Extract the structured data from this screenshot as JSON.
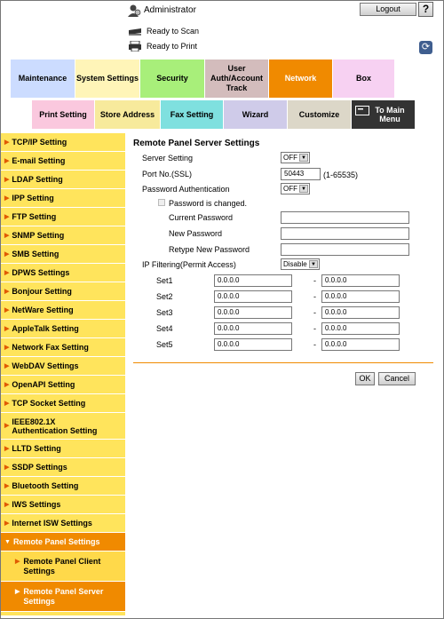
{
  "header": {
    "user": "Administrator",
    "logout_label": "Logout",
    "help_label": "?",
    "status": [
      "Ready to Scan",
      "Ready to Print"
    ]
  },
  "tabs": [
    {
      "label": "Maintenance",
      "color": "#ccdcff"
    },
    {
      "label": "System Settings",
      "color": "#fff5b8"
    },
    {
      "label": "Security",
      "color": "#a8ef7a"
    },
    {
      "label": "User Auth/Account Track",
      "color": "#d3bcbc"
    },
    {
      "label": "Network",
      "color": "#f08a00"
    },
    {
      "label": "Box",
      "color": "#f7d1f2"
    }
  ],
  "subtabs": [
    {
      "label": "Print Setting",
      "color": "#fac8de"
    },
    {
      "label": "Store Address",
      "color": "#f7ea9c"
    },
    {
      "label": "Fax Setting",
      "color": "#7fe0df"
    },
    {
      "label": "Wizard",
      "color": "#cfcbe9"
    },
    {
      "label": "Customize",
      "color": "#dcd7c8"
    },
    {
      "label": "To Main Menu",
      "color": "#333333"
    }
  ],
  "sidebar": {
    "items": [
      "TCP/IP Setting",
      "E-mail Setting",
      "LDAP Setting",
      "IPP Setting",
      "FTP Setting",
      "SNMP Setting",
      "SMB Setting",
      "DPWS Settings",
      "Bonjour Setting",
      "NetWare Setting",
      "AppleTalk Setting",
      "Network Fax Setting",
      "WebDAV Settings",
      "OpenAPI Setting",
      "TCP Socket Setting",
      "IEEE802.1X Authentication Setting",
      "LLTD Setting",
      "SSDP Settings",
      "Bluetooth Setting",
      "IWS Settings",
      "Internet ISW Settings"
    ],
    "active": "Remote Panel Settings",
    "sub": [
      "Remote Panel Client Settings",
      "Remote Panel Server Settings"
    ]
  },
  "form": {
    "title": "Remote Panel Server Settings",
    "server_setting_label": "Server Setting",
    "server_setting_value": "OFF",
    "port_label": "Port No.(SSL)",
    "port_value": "50443",
    "port_range": "(1-65535)",
    "password_auth_label": "Password Authentication",
    "password_auth_value": "OFF",
    "password_changed_label": "Password is changed.",
    "current_password_label": "Current Password",
    "new_password_label": "New Password",
    "retype_password_label": "Retype New Password",
    "ip_filtering_label": "IP Filtering(Permit Access)",
    "ip_filtering_value": "Disable",
    "sets": [
      {
        "label": "Set1",
        "from": "0.0.0.0",
        "to": "0.0.0.0"
      },
      {
        "label": "Set2",
        "from": "0.0.0.0",
        "to": "0.0.0.0"
      },
      {
        "label": "Set3",
        "from": "0.0.0.0",
        "to": "0.0.0.0"
      },
      {
        "label": "Set4",
        "from": "0.0.0.0",
        "to": "0.0.0.0"
      },
      {
        "label": "Set5",
        "from": "0.0.0.0",
        "to": "0.0.0.0"
      }
    ],
    "range_separator": "-",
    "ok_label": "OK",
    "cancel_label": "Cancel"
  }
}
